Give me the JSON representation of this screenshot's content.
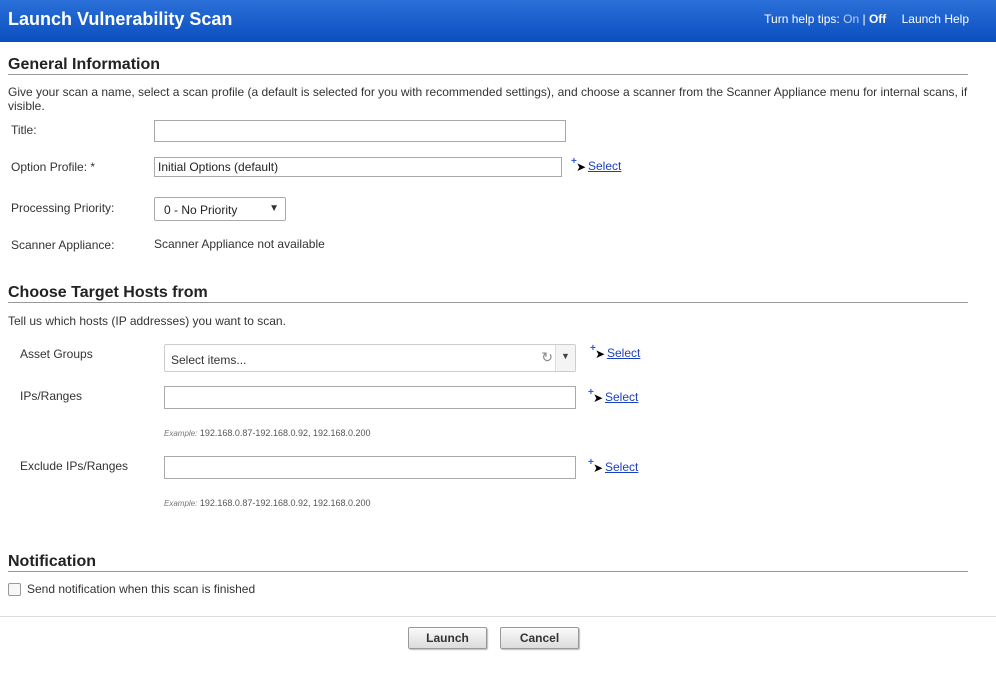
{
  "header": {
    "title": "Launch Vulnerability Scan",
    "help_tips_label": "Turn help tips:",
    "on": "On",
    "separator": "|",
    "off": "Off",
    "launch_help": "Launch Help"
  },
  "general": {
    "heading": "General Information",
    "description": "Give your scan a name, select a scan profile (a default is selected for you with recommended settings), and choose a scanner from the Scanner Appliance menu for internal scans, if visible.",
    "title_label": "Title:",
    "title_value": "",
    "option_profile_label": "Option Profile: *",
    "option_profile_value": "Initial Options (default)",
    "select_link": "Select",
    "priority_label": "Processing Priority:",
    "priority_value": "0 - No Priority",
    "scanner_label": "Scanner Appliance:",
    "scanner_value": "Scanner Appliance not available"
  },
  "targets": {
    "heading": "Choose Target Hosts from",
    "description": "Tell us which hosts (IP addresses) you want to scan.",
    "asset_groups_label": "Asset Groups",
    "asset_groups_placeholder": "Select items...",
    "ips_label": "IPs/Ranges",
    "exclude_label": "Exclude IPs/Ranges",
    "select_link": "Select",
    "example_label": "Example:",
    "example_value": "192.168.0.87-192.168.0.92, 192.168.0.200"
  },
  "notification": {
    "heading": "Notification",
    "checkbox_label": "Send notification when this scan is finished",
    "checked": false
  },
  "footer": {
    "launch": "Launch",
    "cancel": "Cancel"
  }
}
